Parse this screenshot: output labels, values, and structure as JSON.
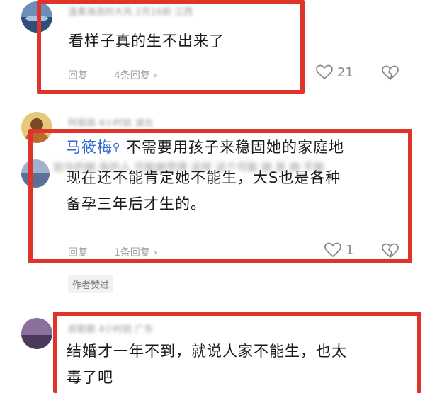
{
  "comments": [
    {
      "meta": "温柔海浪的大风 2月16前 江西",
      "text_lines": [
        "看样子真的生不出来了"
      ],
      "reply_label": "回复",
      "replies_label": "4条回复 ›",
      "like_count": "21"
    },
    {
      "meta": "阿丽丽 4小时前 湖北",
      "username": "马筱梅",
      "text_lines": [
        "不需要用孩子来稳固她的家庭地",
        "现在还不能肯定她不能生，大S也是各种",
        "备孕三年后才生的。"
      ],
      "reply_label": "回复",
      "replies_label": "1条回复 ›",
      "like_count": "1",
      "author_liked": "作者赞过"
    },
    {
      "meta": "叔勒歌 4小时前 广东",
      "text_lines": [
        "结婚才一年不到，就说人家不能生，也太",
        "毒了吧"
      ]
    }
  ],
  "background_blur_text": "如今的她 有的人 可能她觉得 这样 这个可能 她 其 她 不能"
}
